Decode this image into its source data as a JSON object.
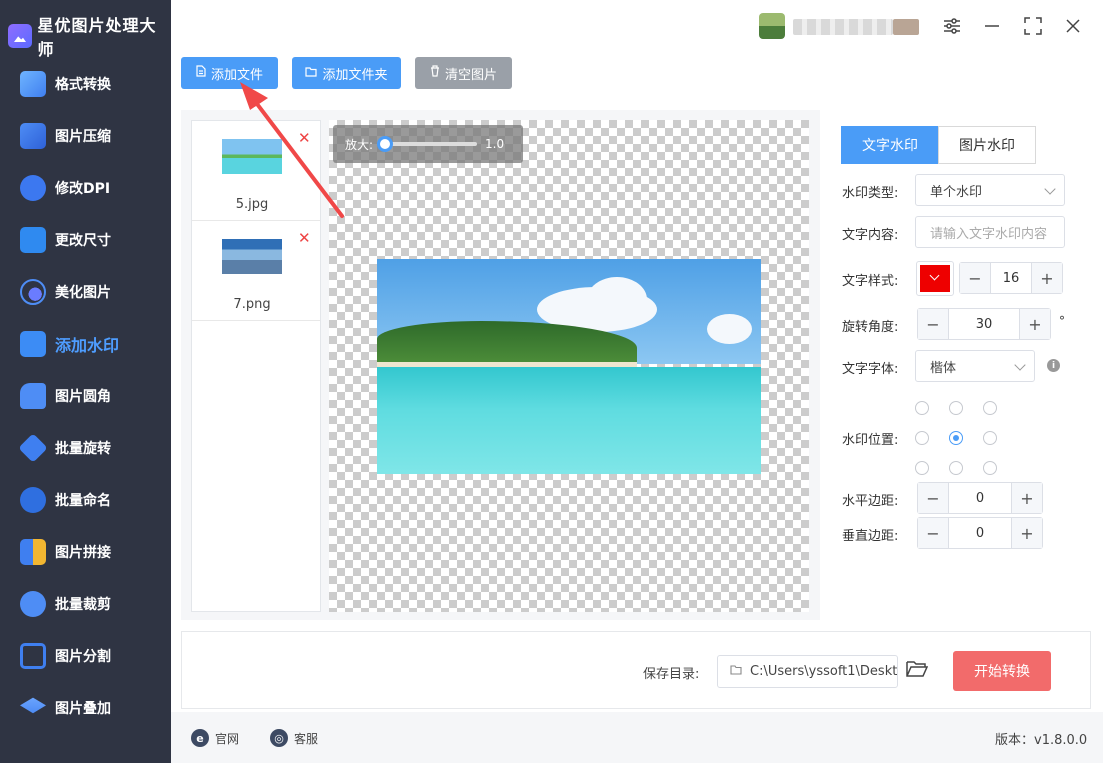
{
  "app": {
    "title": "星优图片处理大师"
  },
  "sidebar": {
    "items": [
      {
        "label": "格式转换",
        "icon": "format-convert-icon"
      },
      {
        "label": "图片压缩",
        "icon": "compress-icon"
      },
      {
        "label": "修改DPI",
        "icon": "dpi-icon"
      },
      {
        "label": "更改尺寸",
        "icon": "resize-icon"
      },
      {
        "label": "美化图片",
        "icon": "beautify-icon"
      },
      {
        "label": "添加水印",
        "icon": "watermark-icon"
      },
      {
        "label": "图片圆角",
        "icon": "round-corner-icon"
      },
      {
        "label": "批量旋转",
        "icon": "rotate-icon"
      },
      {
        "label": "批量命名",
        "icon": "rename-icon"
      },
      {
        "label": "图片拼接",
        "icon": "stitch-icon"
      },
      {
        "label": "批量裁剪",
        "icon": "crop-icon"
      },
      {
        "label": "图片分割",
        "icon": "split-icon"
      },
      {
        "label": "图片叠加",
        "icon": "overlay-icon"
      }
    ],
    "active_index": 5
  },
  "toolbar": {
    "add_file": "添加文件",
    "add_folder": "添加文件夹",
    "clear_images": "清空图片"
  },
  "files": [
    {
      "name": "5.jpg"
    },
    {
      "name": "7.png"
    }
  ],
  "preview": {
    "zoom_label": "放大:",
    "zoom_value": "1.0"
  },
  "panel": {
    "tabs": [
      {
        "label": "文字水印",
        "active": true
      },
      {
        "label": "图片水印",
        "active": false
      }
    ],
    "watermark_type_label": "水印类型:",
    "watermark_type_value": "单个水印",
    "text_content_label": "文字内容:",
    "text_content_placeholder": "请输入文字水印内容",
    "text_style_label": "文字样式:",
    "text_color": "#e00000",
    "font_size": "16",
    "rotate_label": "旋转角度:",
    "rotate_value": "30",
    "degree_symbol": "°",
    "font_label": "文字字体:",
    "font_value": "楷体",
    "position_label": "水印位置:",
    "position_selected": "middle-center",
    "h_margin_label": "水平边距:",
    "h_margin_value": "0",
    "v_margin_label": "垂直边距:",
    "v_margin_value": "0"
  },
  "bottom": {
    "save_dir_label": "保存目录:",
    "save_dir_value": "C:\\Users\\yssoft1\\Deskt",
    "start_button": "开始转换"
  },
  "footer": {
    "website": "官网",
    "support": "客服",
    "version": "版本：v1.8.0.0"
  },
  "colors": {
    "accent": "#4a9cf7",
    "sidebar_bg": "#2f3443",
    "start_button": "#f26b6b"
  }
}
